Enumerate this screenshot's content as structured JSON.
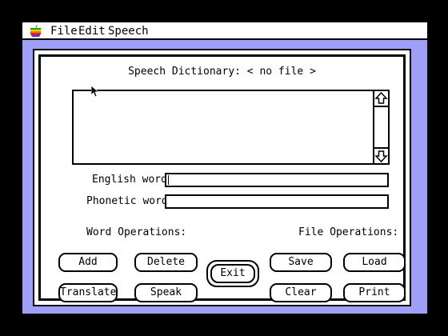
{
  "menubar": {
    "items": [
      {
        "label": "File"
      },
      {
        "label": "Edit"
      },
      {
        "label": "Speech"
      }
    ]
  },
  "dialog": {
    "title": "Speech Dictionary:  < no file >",
    "english_word_label": "English word:",
    "english_word_value": "",
    "phonetic_word_label": "Phonetic word:",
    "phonetic_word_value": "",
    "word_operations_label": "Word Operations:",
    "file_operations_label": "File Operations:",
    "buttons": {
      "add": "Add",
      "delete": "Delete",
      "translate": "Translate",
      "speak": "Speak",
      "exit": "Exit",
      "save": "Save",
      "load": "Load",
      "clear": "Clear",
      "print": "Print"
    }
  },
  "colors": {
    "desktop_border": "#9f9ff7",
    "background": "#ffffff",
    "ink": "#000000"
  },
  "icons": [
    "apple-logo",
    "scroll-up-arrow-icon",
    "scroll-down-arrow-icon",
    "mouse-pointer-icon"
  ]
}
